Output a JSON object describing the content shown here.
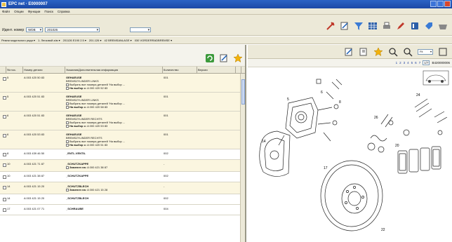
{
  "window": {
    "title": "EPC net · E0000007"
  },
  "menu": [
    "Файл",
    "Опции",
    "Функции",
    "Поиск",
    "Справка"
  ],
  "filter": {
    "label": "Идент. номер",
    "model_value": "WDB",
    "code_value": "201026"
  },
  "breadcrumb": [
    "Ремни модельного ряда",
    "1. Легковой а/м",
    "201126 E190 2.5",
    "201.126",
    "42 BREMSANLAGE",
    "030 VORDERRADBREMSE"
  ],
  "table": {
    "headers": [
      "",
      "№ поз.",
      "Номер детали",
      "Указания/Дополнительная информация",
      "Количество",
      "Версии"
    ],
    "rows": [
      {
        "pos": "5",
        "part": "A 003 420 50 83",
        "name": "GEHAEUSE",
        "sub": "BREMSZYLINDER LINKS",
        "opt1": "Выбрать все номера деталей 'На выбор ...",
        "opt2_label": "На выбор с:",
        "opt2_value": "A 000 420 52 83",
        "qty": "001",
        "alt": true
      },
      {
        "pos": "5",
        "part": "A 003 420 51 83",
        "name": "GEHAEUSE",
        "sub": "BREMSZYLINDER LINKS",
        "opt1": "Выбрать все номера деталей 'На выбор ...",
        "opt2_label": "На выбор с:",
        "opt2_value": "A 000 420 58 83",
        "qty": "001",
        "alt": true
      },
      {
        "pos": "6",
        "part": "A 003 420 51 83",
        "name": "GEHAEUSE",
        "sub": "BREMSZYLINDER RECHTS",
        "opt1": "Выбрать все номера деталей 'На выбор ...",
        "opt2_label": "На выбор с:",
        "opt2_value": "A 000 420 53 83",
        "qty": "001",
        "alt": true
      },
      {
        "pos": "6",
        "part": "A 003 420 53 83",
        "name": "GEHAEUSE",
        "sub": "BREMSZYLINDER RECHTS",
        "opt1": "Выбрать все номера деталей 'На выбор ...",
        "opt2_label": "На выбор с:",
        "opt2_value": "A 000 420 51 83",
        "qty": "001",
        "alt": true
      },
      {
        "pos": "8",
        "part": "A 003 439 46 50",
        "name": "_ENTL.VENTIL",
        "sub": "",
        "opt1": "",
        "opt2_label": "",
        "opt2_value": "",
        "qty": "002",
        "alt": false
      },
      {
        "pos": "10",
        "part": "A 003 421 71 87",
        "name": "_SCHUTZKAPPE",
        "sub": "",
        "opt1": "",
        "opt2_label": "Заменен на:",
        "opt2_value": "A 000 421 38 87",
        "qty": "-",
        "alt": true
      },
      {
        "pos": "10",
        "part": "A 003 421 38 87",
        "name": "_SCHUTZKAPPE",
        "sub": "",
        "opt1": "",
        "opt2_label": "",
        "opt2_value": "",
        "qty": "002",
        "alt": false
      },
      {
        "pos": "14",
        "part": "A 003 421 15 20",
        "name": "_SCHUTZBLECH",
        "sub": "",
        "opt1": "",
        "opt2_label": "Заменен на:",
        "opt2_value": "A 000 421 15 28",
        "qty": "-",
        "alt": true
      },
      {
        "pos": "14",
        "part": "A 003 421 15 20",
        "name": "_SCHUTZBLECH",
        "sub": "",
        "opt1": "",
        "opt2_label": "",
        "opt2_value": "",
        "qty": "002",
        "alt": false
      },
      {
        "pos": "17",
        "part": "A 003 421 07 71",
        "name": "_SCHRAUBE",
        "sub": "",
        "opt1": "",
        "opt2_label": "",
        "opt2_value": "",
        "qty": "004",
        "alt": false
      }
    ]
  },
  "viewer": {
    "zoom": "Fit",
    "pages": [
      "1",
      "2",
      "3",
      "4",
      "5",
      "6",
      "7"
    ],
    "page_indicator": "1/7",
    "doc_code": "B420000006"
  },
  "colors": {
    "title_bar": "#1b49a6",
    "panel": "#ece9d8",
    "row_alt": "#fbf6e0"
  }
}
